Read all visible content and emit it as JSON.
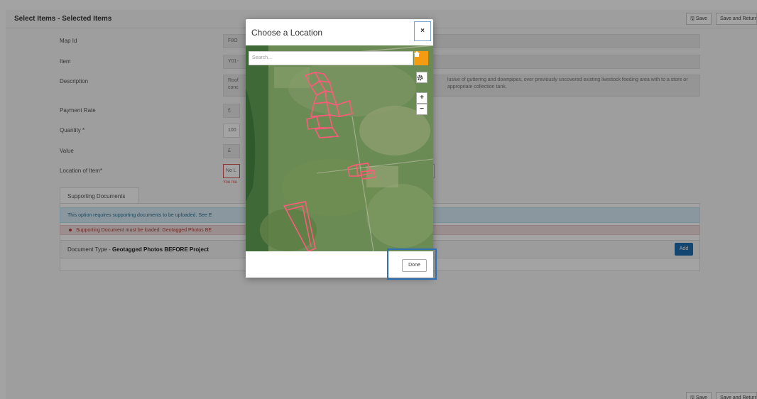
{
  "page": {
    "title": "Select Items - Selected Items",
    "save_label": "Save",
    "save_return_label": "Save and Return"
  },
  "form": {
    "map_id": {
      "label": "Map Id",
      "value": "F8O"
    },
    "item": {
      "label": "Item",
      "value": "Y01-"
    },
    "description": {
      "label": "Description",
      "value_start": "Roof conc",
      "value_end": "lusive of guttering and downpipes, over previously uncovered existing livestock feeding area with to a store or appropriate collection tank."
    },
    "payment_rate": {
      "label": "Payment Rate",
      "value": "£"
    },
    "quantity": {
      "label": "Quantity *",
      "value": "100"
    },
    "value": {
      "label": "Value",
      "value": "£"
    },
    "location": {
      "label": "Location of Item*",
      "value": "No L",
      "error": "You mu"
    }
  },
  "documents": {
    "tab_label": "Supporting Documents",
    "info": "This option requires supporting documents to be uploaded. See E",
    "error": "Supporting Document must be loaded: Geotagged Photos BE",
    "doc_type_label": "Document Type - ",
    "doc_type_value": "Geotagged Photos BEFORE Project",
    "add_label": "Add"
  },
  "modal": {
    "title": "Choose a Location",
    "close_label": "×",
    "search_placeholder": "Search...",
    "zoom_in": "+",
    "zoom_out": "−",
    "done_label": "Done"
  },
  "icons": {
    "home": "home-icon",
    "settings": "gear-icon",
    "save": "floppy-icon"
  },
  "colors": {
    "accent": "#1f6fb2",
    "home_button": "#f39c12",
    "parcel_outline": "#ff5a7a",
    "focus_ring": "#2f6fb3"
  }
}
